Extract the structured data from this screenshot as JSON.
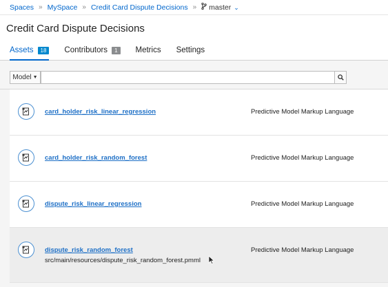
{
  "breadcrumb": {
    "items": [
      "Spaces",
      "MySpace",
      "Credit Card Dispute Decisions"
    ],
    "branch": "master"
  },
  "page": {
    "title": "Credit Card Dispute Decisions"
  },
  "tabs": [
    {
      "label": "Assets",
      "count": "18",
      "active": true
    },
    {
      "label": "Contributors",
      "count": "1",
      "active": false
    },
    {
      "label": "Metrics",
      "count": null,
      "active": false
    },
    {
      "label": "Settings",
      "count": null,
      "active": false
    }
  ],
  "filter": {
    "type_label": "Model",
    "input_value": "",
    "placeholder": ""
  },
  "assets": [
    {
      "name": "card_holder_risk_linear_regression",
      "type": "Predictive Model Markup Language",
      "path": ""
    },
    {
      "name": "card_holder_risk_random_forest",
      "type": "Predictive Model Markup Language",
      "path": ""
    },
    {
      "name": "dispute_risk_linear_regression",
      "type": "Predictive Model Markup Language",
      "path": ""
    },
    {
      "name": "dispute_risk_random_forest",
      "type": "Predictive Model Markup Language",
      "path": "src/main/resources/dispute_risk_random_forest.pmml"
    }
  ],
  "colors": {
    "accent": "#0066cc",
    "badge": "#0088ce",
    "badge_grey": "#8b8d8f",
    "link": "#1d6fc6"
  },
  "icons": {
    "asset": "pmml-file-icon",
    "search": "search-icon",
    "branch": "branch-icon"
  }
}
